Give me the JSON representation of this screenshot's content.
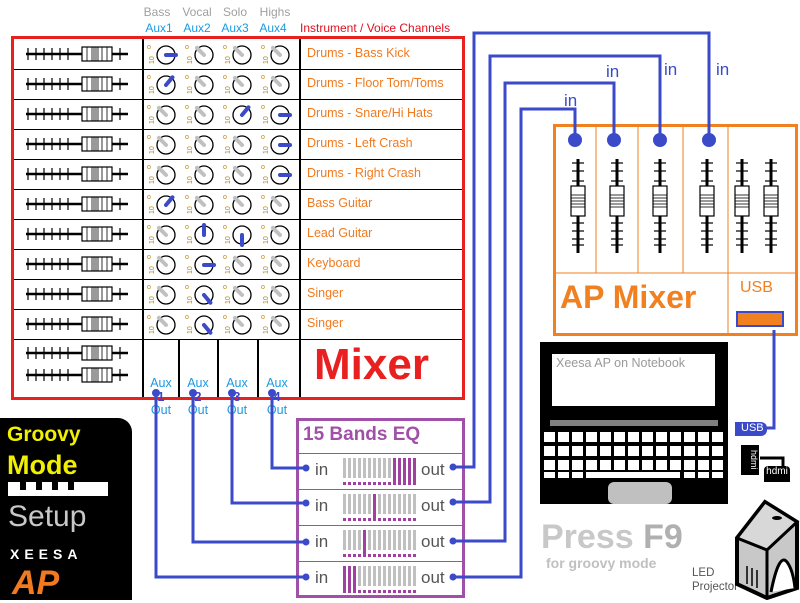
{
  "aux_headers": [
    {
      "role": "Bass",
      "aux": "Aux1"
    },
    {
      "role": "Vocal",
      "aux": "Aux2"
    },
    {
      "role": "Solo",
      "aux": "Aux3"
    },
    {
      "role": "Highs",
      "aux": "Aux4"
    }
  ],
  "channels_title": "Instrument / Voice Channels",
  "channels": [
    {
      "name": "Drums - Bass Kick",
      "knobs": [
        "active-right",
        "off",
        "off",
        "off"
      ]
    },
    {
      "name": "Drums - Floor Tom/Toms",
      "knobs": [
        "active-upright",
        "off",
        "off",
        "off"
      ]
    },
    {
      "name": "Drums - Snare/Hi Hats",
      "knobs": [
        "off",
        "off",
        "active-upright",
        "active-right"
      ]
    },
    {
      "name": "Drums - Left Crash",
      "knobs": [
        "off",
        "off",
        "off",
        "active-right"
      ]
    },
    {
      "name": "Drums - Right Crash",
      "knobs": [
        "off",
        "off",
        "off",
        "active-right"
      ]
    },
    {
      "name": "Bass Guitar",
      "knobs": [
        "active-upright",
        "off",
        "off",
        "off"
      ]
    },
    {
      "name": "Lead Guitar",
      "knobs": [
        "off",
        "active-up",
        "active-down",
        "off"
      ]
    },
    {
      "name": "Keyboard",
      "knobs": [
        "off",
        "active-right",
        "off",
        "off"
      ]
    },
    {
      "name": "Singer",
      "knobs": [
        "off",
        "active-downright",
        "off",
        "off"
      ]
    },
    {
      "name": "Singer",
      "knobs": [
        "off",
        "active-downright",
        "off",
        "off"
      ]
    }
  ],
  "aux_outputs": [
    {
      "line1": "Aux",
      "num": "1",
      "line3": "Out"
    },
    {
      "line1": "Aux",
      "num": "2",
      "line3": "Out"
    },
    {
      "line1": "Aux",
      "num": "3",
      "line3": "Out"
    },
    {
      "line1": "Aux",
      "num": "4",
      "line3": "Out"
    }
  ],
  "mixer_label": "Mixer",
  "eq": {
    "title": "15 Bands EQ",
    "in_label": "in",
    "out_label": "out",
    "rows": [
      {
        "source": "Aux 4",
        "boosted_bands": [
          11,
          12,
          13,
          14,
          15
        ],
        "curve": "high-shelf"
      },
      {
        "source": "Aux 3",
        "boosted_bands": [
          7
        ],
        "curve": "peak-mid"
      },
      {
        "source": "Aux 2",
        "boosted_bands": [
          5
        ],
        "curve": "peak-low-mid"
      },
      {
        "source": "Aux 1",
        "boosted_bands": [
          1,
          2,
          3
        ],
        "curve": "low-shelf"
      }
    ]
  },
  "ap_mixer": {
    "title": "AP Mixer",
    "usb_label": "USB",
    "input_label": "in",
    "inputs": 4,
    "faders": 6
  },
  "groovy": {
    "line1": "Groovy",
    "line2": "Mode",
    "line3": "Setup",
    "brand1": "XEESA",
    "brand2": "AP"
  },
  "notebook": {
    "screen_text": "Xeesa AP on Notebook",
    "usb_plug": "USB",
    "hdmi_plug": "hdmi",
    "hdmi_plug2": "hdmi"
  },
  "press": {
    "text": "Press ",
    "key": "F9",
    "sub": "for groovy mode"
  },
  "projector": {
    "line1": "LED",
    "line2": "Projector"
  },
  "colors": {
    "mixer_border": "#e82020",
    "wire": "#3a4ac8",
    "eq_border": "#a050a8",
    "ap_border": "#f08020",
    "channel_text": "#f07a20",
    "aux_text": "#1a9ae0",
    "groovy_yellow": "#f0f000"
  }
}
